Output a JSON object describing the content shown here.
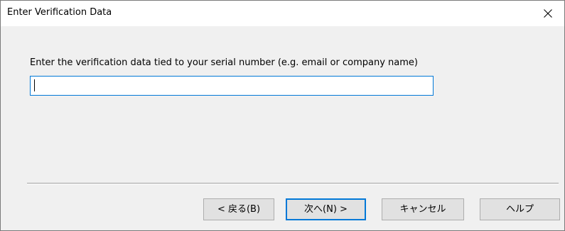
{
  "window": {
    "title": "Enter Verification Data",
    "close_icon": "close-icon"
  },
  "form": {
    "prompt": "Enter the verification data tied to your serial number (e.g. email or company name)",
    "input_value": "",
    "input_focused": true
  },
  "buttons": {
    "back": "< 戻る(B)",
    "next": "次へ(N) >",
    "cancel": "キャンセル",
    "help": "ヘルプ"
  },
  "colors": {
    "focus_accent": "#0078d7",
    "dialog_background": "#f0f0f0",
    "button_face": "#e1e1e1"
  }
}
